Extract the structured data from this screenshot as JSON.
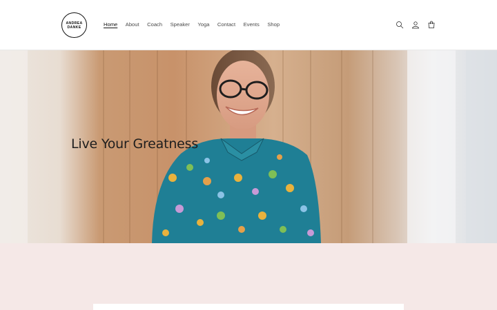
{
  "logo": {
    "line1": "ANDREA",
    "line2": "DANKE"
  },
  "nav": {
    "items": [
      {
        "label": "Home",
        "active": true
      },
      {
        "label": "About",
        "active": false
      },
      {
        "label": "Coach",
        "active": false
      },
      {
        "label": "Speaker",
        "active": false
      },
      {
        "label": "Yoga",
        "active": false
      },
      {
        "label": "Contact",
        "active": false
      },
      {
        "label": "Events",
        "active": false
      },
      {
        "label": "Shop",
        "active": false
      }
    ]
  },
  "header_icons": [
    "search-icon",
    "account-icon",
    "cart-icon"
  ],
  "hero": {
    "title": "Live Your Greatness"
  },
  "colors": {
    "section_background": "#f5e8e7",
    "text": "#121212"
  }
}
